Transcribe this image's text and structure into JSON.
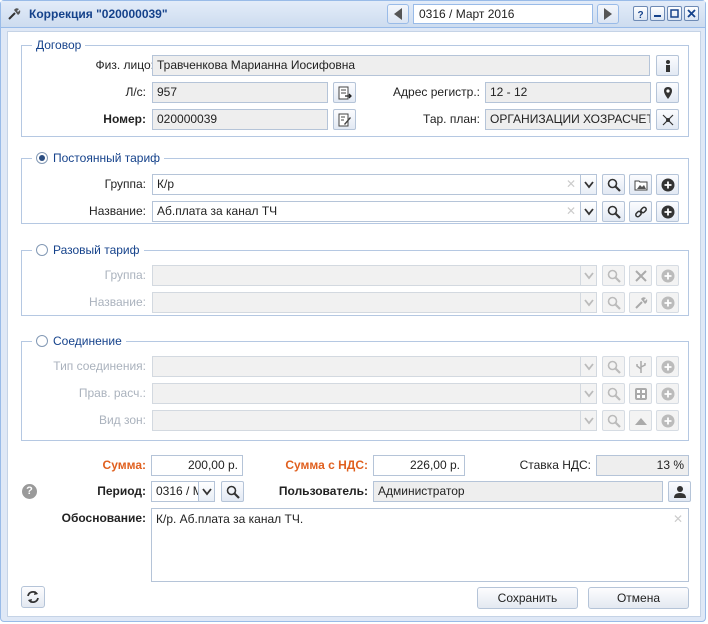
{
  "window": {
    "title": "Коррекция \"020000039\"",
    "period": "0316 / Март 2016"
  },
  "contract": {
    "legend": "Договор",
    "person_label": "Физ. лицо:",
    "person_value": "Травченкова Марианна Иосифовна",
    "account_label": "Л/с:",
    "account_value": "957",
    "address_label": "Адрес регистр.:",
    "address_value": "12 - 12",
    "number_label": "Номер:",
    "number_value": "020000039",
    "plan_label": "Тар. план:",
    "plan_value": "ОРГАНИЗАЦИИ ХОЗРАСЧЕТНЫЕ"
  },
  "permanent": {
    "legend": "Постоянный тариф",
    "group_label": "Группа:",
    "group_value": "К/р",
    "name_label": "Название:",
    "name_value": "Аб.плата за канал ТЧ"
  },
  "onetime": {
    "legend": "Разовый тариф",
    "group_label": "Группа:",
    "name_label": "Название:"
  },
  "connection": {
    "legend": "Соединение",
    "type_label": "Тип соединения:",
    "calc_label": "Прав. расч.:",
    "zone_label": "Вид зон:"
  },
  "summary": {
    "sum_label": "Сумма:",
    "sum_value": "200,00 р.",
    "sum_vat_label": "Сумма с НДС:",
    "sum_vat_value": "226,00 р.",
    "vat_rate_label": "Ставка НДС:",
    "vat_rate_value": "13 %",
    "period_label": "Период:",
    "period_value": "0316 / M",
    "user_label": "Пользователь:",
    "user_value": "Администратор",
    "reason_label": "Обоснование:",
    "reason_value": "К/р. Аб.плата за канал ТЧ."
  },
  "footer": {
    "save_label": "Сохранить",
    "cancel_label": "Отмена"
  },
  "colors": {
    "accent": "#15428b",
    "required": "#e0601f"
  }
}
